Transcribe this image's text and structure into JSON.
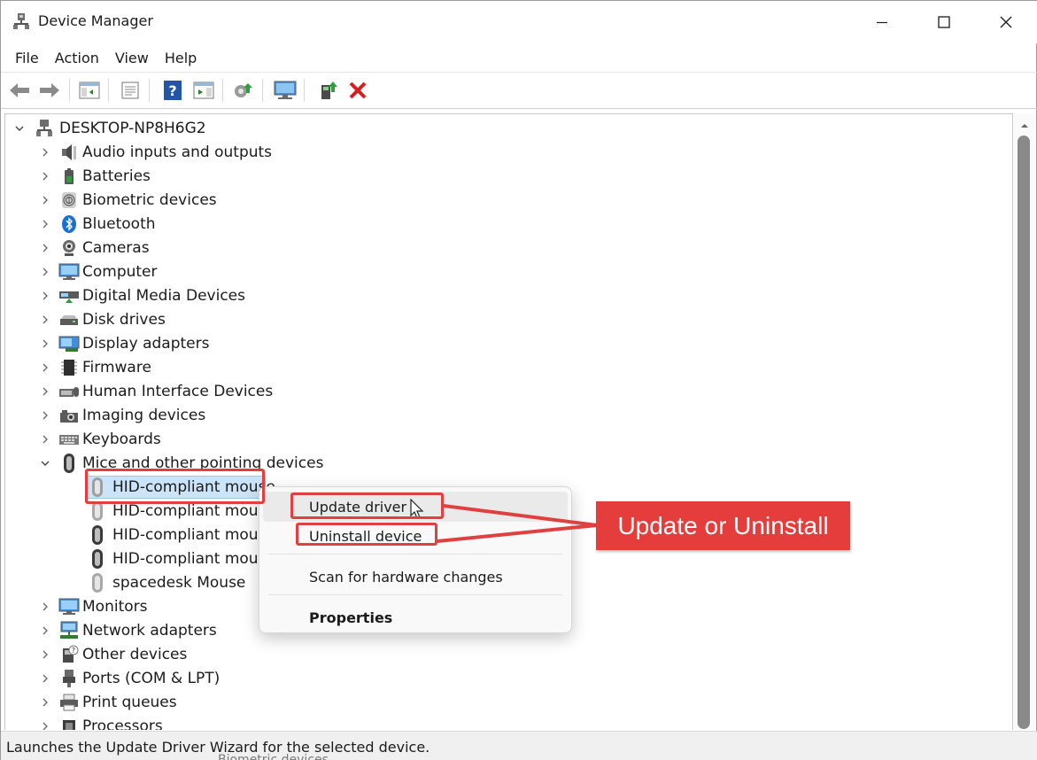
{
  "window": {
    "title": "Device Manager"
  },
  "menu": [
    "File",
    "Action",
    "View",
    "Help"
  ],
  "toolbar": {
    "icons": [
      "back-arrow-icon",
      "forward-arrow-icon",
      "show-hide-console-tree-icon",
      "properties-sheet-icon",
      "help-icon",
      "action-pane-icon",
      "scan-hardware-icon",
      "computer-monitor-icon",
      "update-driver-icon",
      "uninstall-x-icon"
    ]
  },
  "tree": {
    "root": "DESKTOP-NP8H6G2",
    "categories": [
      "Audio inputs and outputs",
      "Batteries",
      "Biometric devices",
      "Bluetooth",
      "Cameras",
      "Computer",
      "Digital Media Devices",
      "Disk drives",
      "Display adapters",
      "Firmware",
      "Human Interface Devices",
      "Imaging devices",
      "Keyboards",
      "Mice and other pointing devices"
    ],
    "mice_children": [
      "HID-compliant mouse",
      "HID-compliant mouse",
      "HID-compliant mouse",
      "HID-compliant mouse",
      "spacedesk Mouse"
    ],
    "categories_after": [
      "Monitors",
      "Network adapters",
      "Other devices",
      "Ports (COM & LPT)",
      "Print queues",
      "Processors"
    ]
  },
  "context_menu": {
    "update_driver": "Update driver",
    "uninstall_device": "Uninstall device",
    "scan": "Scan for hardware changes",
    "properties": "Properties"
  },
  "annotation": {
    "callout": "Update or Uninstall",
    "color": "#e53c3c"
  },
  "status_bar": {
    "text": "Launches the Update Driver Wizard for the selected device."
  },
  "behind_text": "Biometric devices",
  "colors": {
    "selection": "#cce4f7",
    "accent_red": "#e04040",
    "accent_blue": "#0067c0"
  }
}
